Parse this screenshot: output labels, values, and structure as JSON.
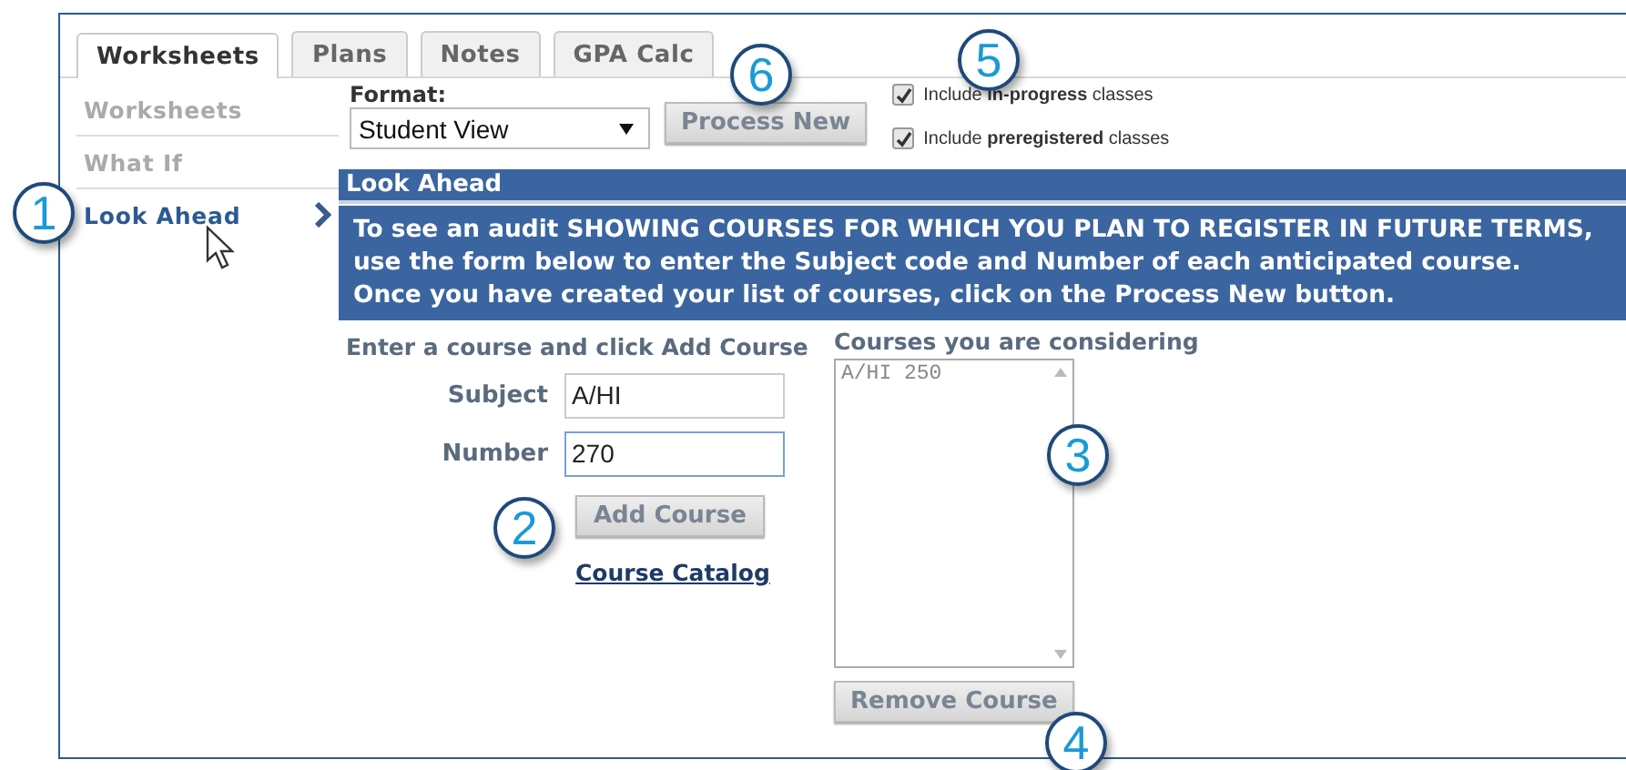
{
  "tabs": [
    {
      "label": "Worksheets",
      "selected": true
    },
    {
      "label": "Plans",
      "selected": false
    },
    {
      "label": "Notes",
      "selected": false
    },
    {
      "label": "GPA Calc",
      "selected": false
    }
  ],
  "sidebar": {
    "items": [
      {
        "label": "Worksheets",
        "selected": false
      },
      {
        "label": "What If",
        "selected": false
      },
      {
        "label": "Look Ahead",
        "selected": true
      }
    ]
  },
  "format": {
    "label": "Format:",
    "value": "Student View"
  },
  "process_button": "Process New",
  "options": [
    {
      "label": "Include **in-progress** classes",
      "checked": true
    },
    {
      "label": "Include **preregistered** classes",
      "checked": true
    }
  ],
  "look_ahead": {
    "title": "Look Ahead",
    "instructions": [
      "To see an audit SHOWING COURSES FOR WHICH YOU PLAN TO REGISTER IN FUTURE TERMS,",
      "use the form below to enter the Subject code and Number of each anticipated course.",
      "Once you have created your list of courses, click on the Process New button."
    ]
  },
  "form": {
    "heading": "Enter a course and click Add Course",
    "fields": [
      {
        "label": "Subject",
        "value": "A/HI",
        "focused": false
      },
      {
        "label": "Number",
        "value": "270",
        "focused": true
      }
    ],
    "add_button": "Add Course",
    "catalog_link": "Course Catalog"
  },
  "considering": {
    "heading": "Courses you are considering",
    "courses": [
      "A/HI 250"
    ],
    "remove_button": "Remove Course"
  },
  "callouts": [
    "1",
    "2",
    "3",
    "4",
    "5",
    "6"
  ]
}
